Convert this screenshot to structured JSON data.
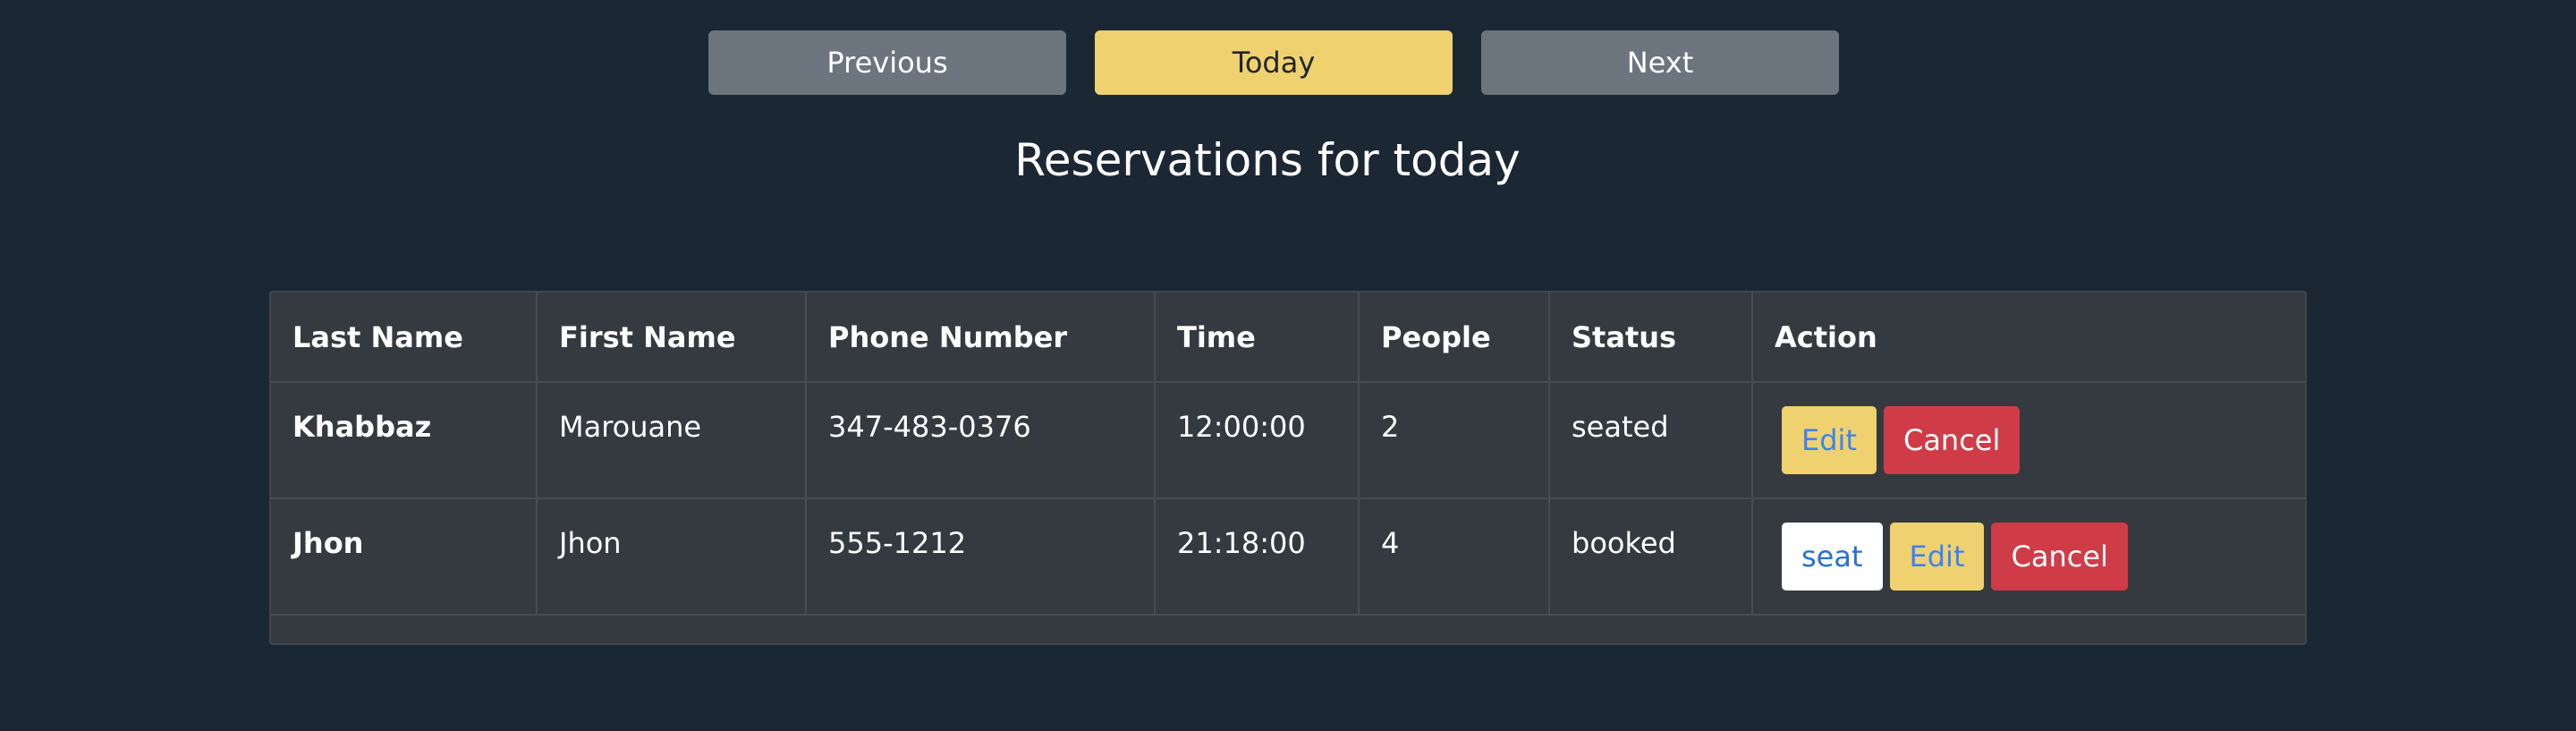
{
  "nav": {
    "previous_label": "Previous",
    "today_label": "Today",
    "next_label": "Next"
  },
  "heading": "Reservations for today",
  "table": {
    "headers": [
      "Last Name",
      "First Name",
      "Phone Number",
      "Time",
      "People",
      "Status",
      "Action"
    ],
    "rows": [
      {
        "last_name": "Khabbaz",
        "first_name": "Marouane",
        "phone": "347-483-0376",
        "time": "12:00:00",
        "people": "2",
        "status": "seated",
        "actions": {
          "edit": "Edit",
          "cancel": "Cancel"
        }
      },
      {
        "last_name": "Jhon",
        "first_name": "Jhon",
        "phone": "555-1212",
        "time": "21:18:00",
        "people": "4",
        "status": "booked",
        "actions": {
          "seat": "seat",
          "edit": "Edit",
          "cancel": "Cancel"
        }
      }
    ]
  },
  "colors": {
    "background": "#1b2733",
    "table_bg": "#343a40",
    "secondary_button": "#6c757d",
    "warning_button": "#efd26f",
    "danger_button": "#cf3c47",
    "link_blue": "#3b82f6"
  }
}
